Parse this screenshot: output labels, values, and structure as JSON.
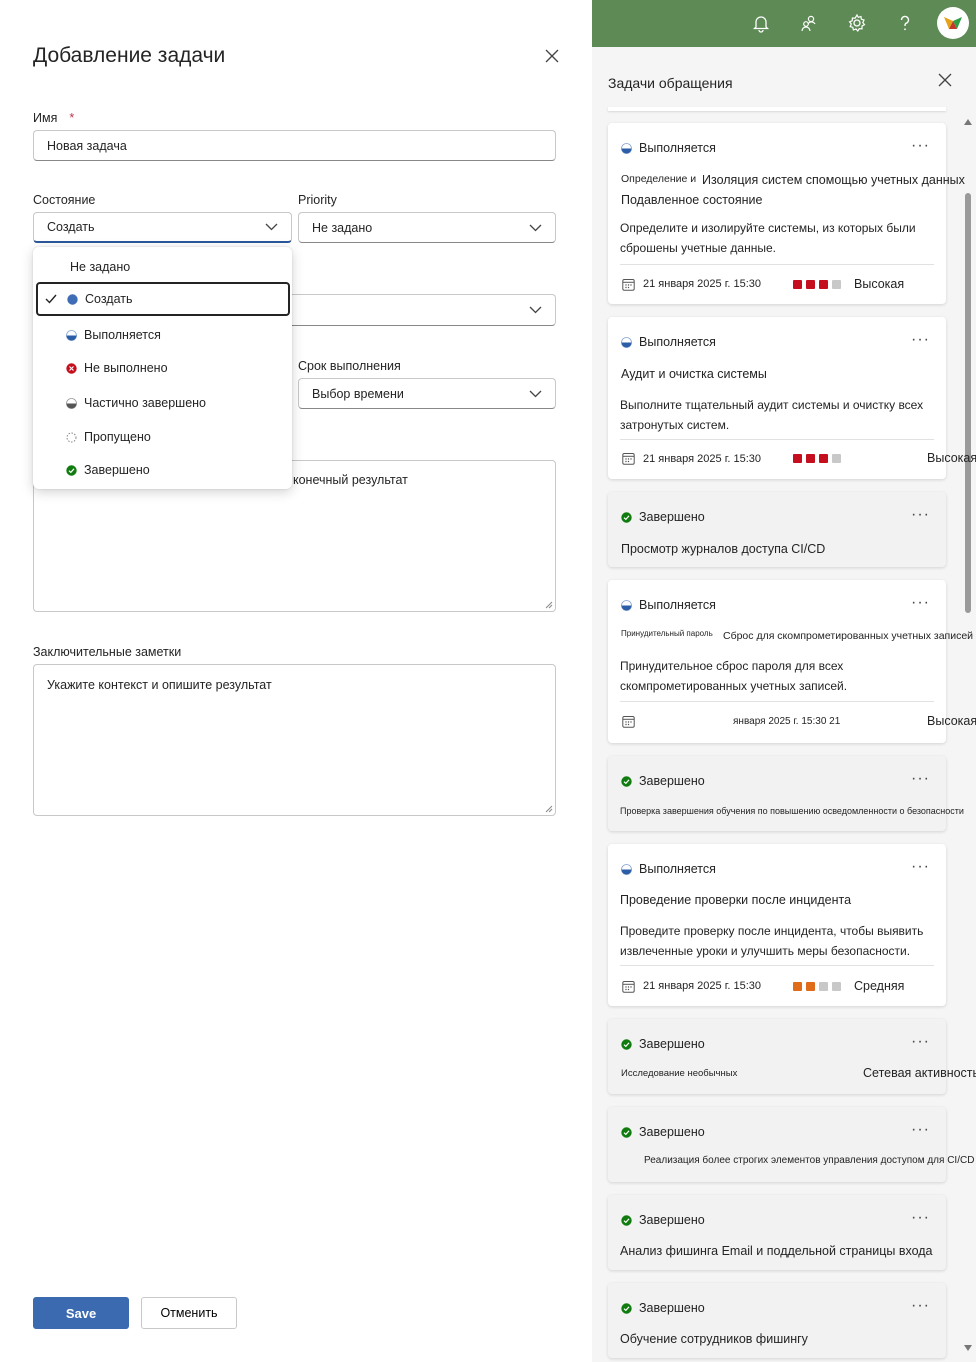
{
  "form": {
    "title": "Добавление задачи",
    "name_label": "Имя",
    "required_mark": "*",
    "name_value": "Новая задача",
    "state_label": "Состояние",
    "state_value": "Создать",
    "priority_label": "Priority",
    "priority_value": "Не задано",
    "due_label": "Срок выполнения",
    "due_value": "Выбор времени",
    "description_partial": "конечный результат",
    "notes_label": "Заключительные заметки",
    "notes_placeholder": "Укажите контекст и опишите результат",
    "save_label": "Save",
    "cancel_label": "Отменить"
  },
  "state_dropdown": {
    "items": [
      {
        "label": "Не задано",
        "icon": "none"
      },
      {
        "label": "Создать",
        "icon": "new-circle-icon",
        "selected": true
      },
      {
        "label": "Выполняется",
        "icon": "half-circle-icon"
      },
      {
        "label": "Не выполнено",
        "icon": "failed-icon"
      },
      {
        "label": "Частично завершено",
        "icon": "partial-icon"
      },
      {
        "label": "Пропущено",
        "icon": "skipped-icon"
      },
      {
        "label": "Завершено",
        "icon": "completed-icon"
      }
    ]
  },
  "panel": {
    "title": "Задачи обращения",
    "cards": [
      {
        "status": "Выполняется",
        "title_a": "Определение и",
        "title_b": "Изоляция систем спомощью учетных данных",
        "title_c": "Подавленное состояние",
        "desc": "Определите и изолируйте системы, из которых были сброшены учетные данные.",
        "date": "21 января 2025 г. 15:30",
        "priority": "Высокая"
      },
      {
        "status": "Выполняется",
        "title": "Аудит и очистка системы",
        "desc": "Выполните тщательный аудит системы и очистку всех затронутых систем.",
        "date": "21 января 2025 г. 15:30",
        "priority": "Высокая"
      },
      {
        "status": "Завершено",
        "title": "Просмотр журналов доступа CI/CD"
      },
      {
        "status": "Выполняется",
        "title_a": "Принудительный пароль",
        "title_b": "Сброс для скомпрометированных учетных записей",
        "desc": "Принудительное сброс пароля для всех скомпрометированных учетных записей.",
        "date": "января 2025 г. 15:30 21",
        "priority": "Высокая"
      },
      {
        "status": "Завершено",
        "title": "Проверка завершения обучения по повышению осведомленности о безопасности"
      },
      {
        "status": "Выполняется",
        "title": "Проведение проверки после инцидента",
        "desc": "Проведите проверку после инцидента, чтобы выявить извлеченные уроки и улучшить меры безопасности.",
        "date": "21 января 2025 г. 15:30",
        "priority": "Средняя"
      },
      {
        "status": "Завершено",
        "title_a": "Исследование необычных",
        "title_b": "Сетевая активность"
      },
      {
        "status": "Завершено",
        "title": "Реализация более строгих элементов управления доступом для CI/CD"
      },
      {
        "status": "Завершено",
        "title": "Анализ фишинга Email и поддельной страницы входа"
      },
      {
        "status": "Завершено",
        "title": "Обучение сотрудников фишингу"
      }
    ]
  },
  "colors": {
    "topbar": "#5d8a55",
    "save_button": "#3b6ab0",
    "priority_high": "#c50f1f",
    "priority_medium": "#e06c1a",
    "priority_empty": "#c8c8c8",
    "completed": "#107c10",
    "in_progress": "#2b5ea7"
  }
}
